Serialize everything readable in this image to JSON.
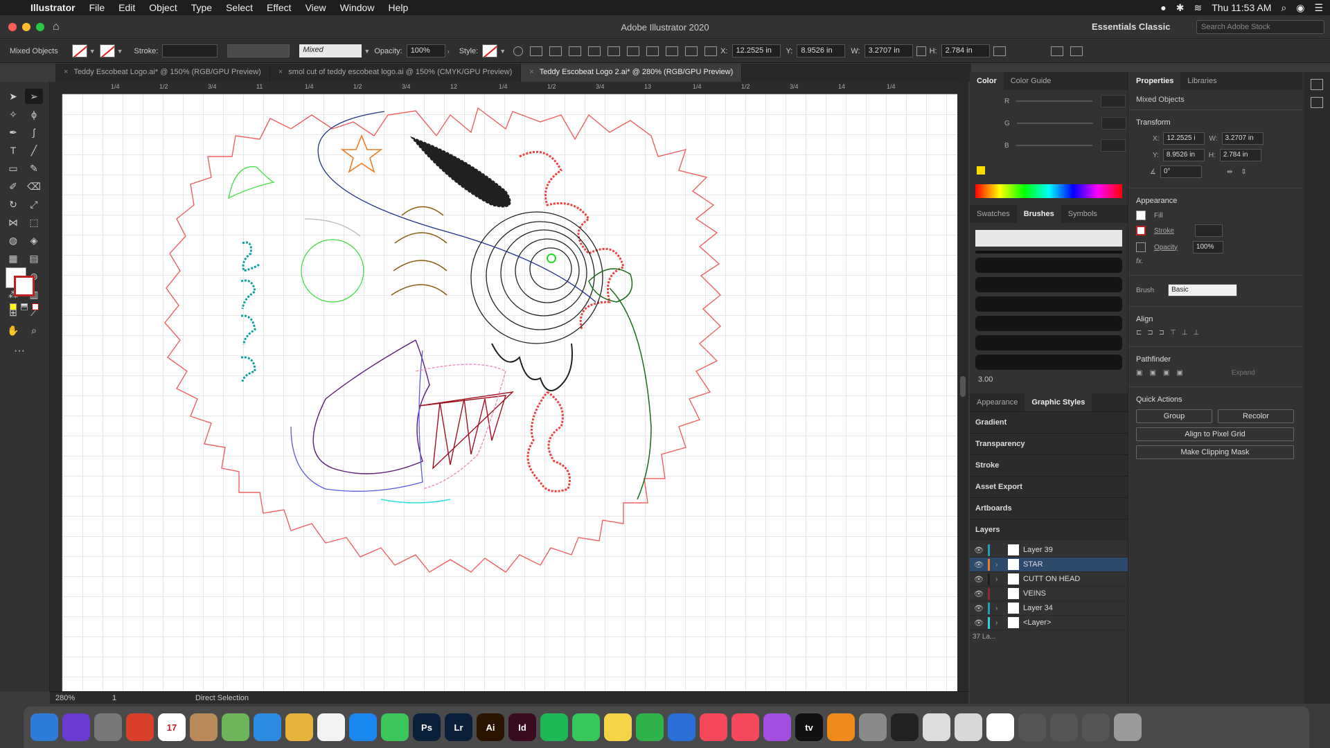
{
  "menubar": {
    "app": "Illustrator",
    "items": [
      "File",
      "Edit",
      "Object",
      "Type",
      "Select",
      "Effect",
      "View",
      "Window",
      "Help"
    ],
    "clock": "Thu 11:53 AM"
  },
  "titlebar": {
    "title": "Adobe Illustrator 2020",
    "workspace": "Essentials Classic",
    "search_placeholder": "Search Adobe Stock"
  },
  "controlbar": {
    "selection": "Mixed Objects",
    "stroke_label": "Stroke:",
    "mixed_value": "Mixed",
    "opacity_label": "Opacity:",
    "opacity_value": "100%",
    "style_label": "Style:",
    "x_label": "X:",
    "x_value": "12.2525 in",
    "y_label": "Y:",
    "y_value": "8.9526 in",
    "w_label": "W:",
    "w_value": "3.2707 in",
    "h_label": "H:",
    "h_value": "2.784 in"
  },
  "tabs": [
    {
      "label": "Teddy Escobeat Logo.ai* @ 150% (RGB/GPU Preview)"
    },
    {
      "label": "smol cut of teddy escobeat logo.ai @ 150% (CMYK/GPU Preview)"
    },
    {
      "label": "Teddy Escobeat Logo 2.ai* @ 280% (RGB/GPU Preview)"
    }
  ],
  "ruler_ticks": [
    "1/4",
    "1/2",
    "3/4",
    "11",
    "1/4",
    "1/2",
    "3/4",
    "12",
    "1/4",
    "1/2",
    "3/4",
    "13",
    "1/4",
    "1/2",
    "3/4",
    "14",
    "1/4"
  ],
  "status": {
    "zoom": "280%",
    "page": "1",
    "tool": "Direct Selection"
  },
  "color_panel": {
    "tabs": [
      "Color",
      "Color Guide"
    ],
    "channels": [
      "R",
      "G",
      "B"
    ]
  },
  "brushes_panel": {
    "tabs": [
      "Swatches",
      "Brushes",
      "Symbols"
    ],
    "size": "3.00"
  },
  "appearance_tabs": [
    "Appearance",
    "Graphic Styles"
  ],
  "stacked_panels": [
    "Gradient",
    "Transparency",
    "Stroke",
    "Asset Export",
    "Artboards",
    "Layers"
  ],
  "layers": [
    {
      "name": "Layer 39",
      "color": "#1fa0c0",
      "expand": ""
    },
    {
      "name": "STAR",
      "color": "#f07a20",
      "expand": "›"
    },
    {
      "name": "CUTT ON HEAD",
      "color": "#202020",
      "expand": "›"
    },
    {
      "name": "VEINS",
      "color": "#8a2a2a",
      "expand": ""
    },
    {
      "name": "Layer 34",
      "color": "#1fa0c0",
      "expand": "›"
    },
    {
      "name": "<Layer>",
      "color": "#30d0e0",
      "expand": "›"
    }
  ],
  "layers_count": "37 La...",
  "properties": {
    "tabs": [
      "Properties",
      "Libraries"
    ],
    "selection": "Mixed Objects",
    "transform": "Transform",
    "x_label": "X:",
    "x_value": "12.2525 i",
    "w_label": "W:",
    "w_value": "3.2707 in",
    "y_label": "Y:",
    "y_value": "8.9526 in",
    "h_label": "H:",
    "h_value": "2.784 in",
    "angle_value": "0°",
    "appearance": "Appearance",
    "fill": "Fill",
    "stroke": "Stroke",
    "opacity": "Opacity",
    "opacity_value": "100%",
    "fx": "fx.",
    "brush": "Brush",
    "brush_value": "Basic",
    "align": "Align",
    "pathfinder": "Pathfinder",
    "expand": "Expand",
    "quick_actions": "Quick Actions",
    "group": "Group",
    "recolor": "Recolor",
    "align_pixel": "Align to Pixel Grid",
    "clipping": "Make Clipping Mask"
  },
  "dock": [
    {
      "name": "finder",
      "label": "",
      "color": "#2f7bd8"
    },
    {
      "name": "siri",
      "label": "",
      "color": "#6a3bd0"
    },
    {
      "name": "launchpad",
      "label": "",
      "color": "#777"
    },
    {
      "name": "chrome",
      "label": "",
      "color": "#d9402b"
    },
    {
      "name": "calendar",
      "label": "17",
      "color": "#ffffff"
    },
    {
      "name": "contacts",
      "label": "",
      "color": "#b88a5a"
    },
    {
      "name": "maps",
      "label": "",
      "color": "#6cb35a"
    },
    {
      "name": "safari",
      "label": "",
      "color": "#2a8be0"
    },
    {
      "name": "photos",
      "label": "",
      "color": "#e7b23a"
    },
    {
      "name": "reminders",
      "label": "",
      "color": "#f3f3f3"
    },
    {
      "name": "appstore",
      "label": "",
      "color": "#1a86f0"
    },
    {
      "name": "messages",
      "label": "",
      "color": "#3cc55a"
    },
    {
      "name": "photoshop",
      "label": "Ps",
      "color": "#0a1f3a"
    },
    {
      "name": "lightroom",
      "label": "Lr",
      "color": "#0a1f3a"
    },
    {
      "name": "illustrator",
      "label": "Ai",
      "color": "#2a1400"
    },
    {
      "name": "indesign",
      "label": "Id",
      "color": "#3a0a1e"
    },
    {
      "name": "spotify",
      "label": "",
      "color": "#1db954"
    },
    {
      "name": "facetime",
      "label": "",
      "color": "#35c759"
    },
    {
      "name": "notes",
      "label": "",
      "color": "#f5d547"
    },
    {
      "name": "numbers",
      "label": "",
      "color": "#2eb24a"
    },
    {
      "name": "keynote",
      "label": "",
      "color": "#2a6fd8"
    },
    {
      "name": "news",
      "label": "",
      "color": "#f5485a"
    },
    {
      "name": "music",
      "label": "",
      "color": "#f5485a"
    },
    {
      "name": "podcasts",
      "label": "",
      "color": "#a24ee0"
    },
    {
      "name": "tv",
      "label": "tv",
      "color": "#111111"
    },
    {
      "name": "books",
      "label": "",
      "color": "#f08a1a"
    },
    {
      "name": "system-prefs",
      "label": "",
      "color": "#8a8a8a"
    },
    {
      "name": "activity-monitor",
      "label": "",
      "color": "#222222"
    },
    {
      "name": "preview",
      "label": "",
      "color": "#dddddd"
    },
    {
      "name": "acrobat",
      "label": "",
      "color": "#d8d8d8"
    },
    {
      "name": "gmail",
      "label": "",
      "color": "#ffffff"
    },
    {
      "name": "window-1",
      "label": "",
      "color": "#555555"
    },
    {
      "name": "window-2",
      "label": "",
      "color": "#555555"
    },
    {
      "name": "window-3",
      "label": "",
      "color": "#555555"
    },
    {
      "name": "trash",
      "label": "",
      "color": "#9a9a9a"
    }
  ]
}
